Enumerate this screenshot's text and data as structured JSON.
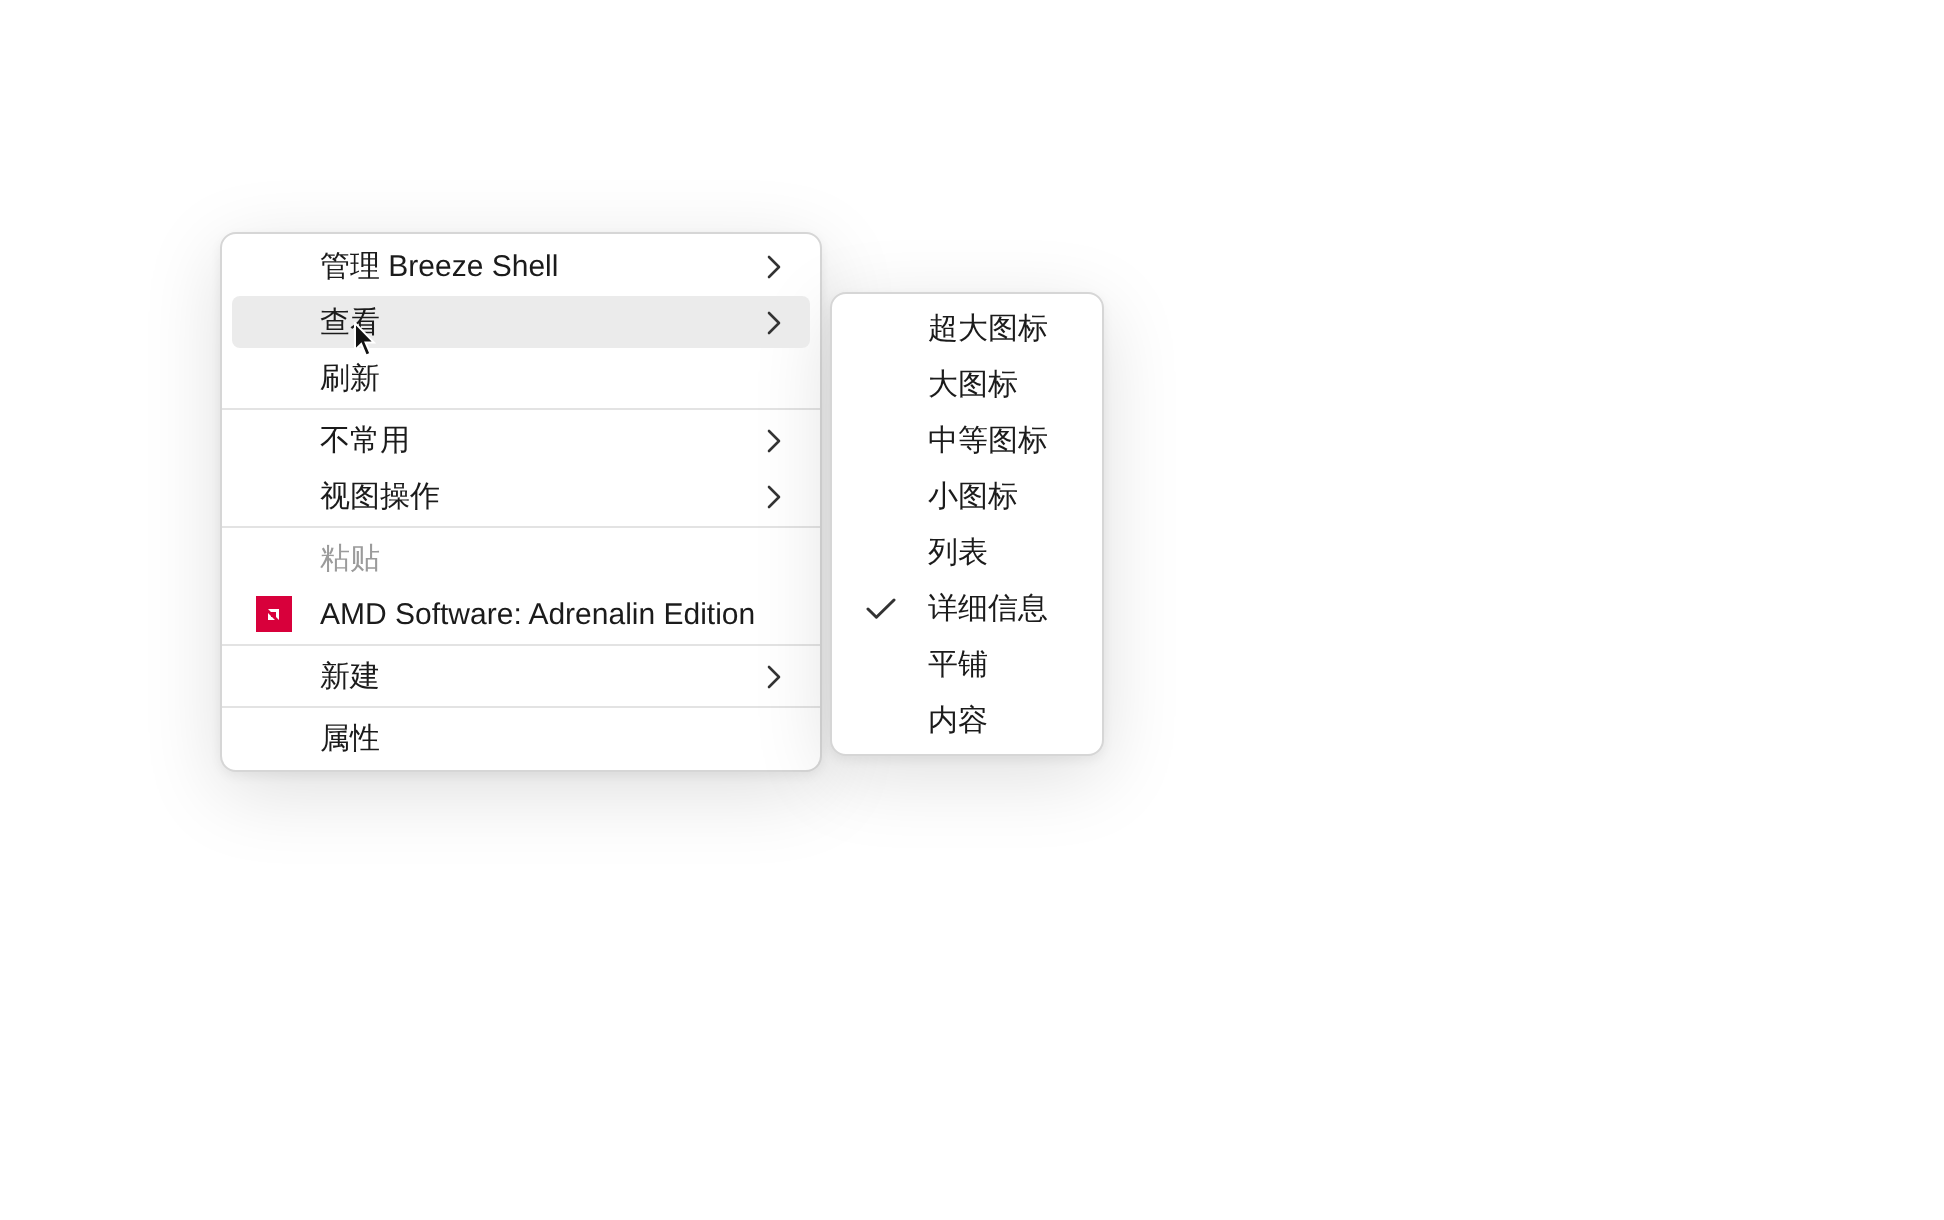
{
  "context_menu": {
    "items": [
      {
        "kind": "submenu",
        "label": "管理 Breeze Shell",
        "selected": false,
        "disabled": false
      },
      {
        "kind": "submenu",
        "label": "查看",
        "selected": true,
        "disabled": false
      },
      {
        "kind": "command",
        "label": "刷新",
        "selected": false,
        "disabled": false
      },
      {
        "kind": "separator"
      },
      {
        "kind": "submenu",
        "label": "不常用",
        "selected": false,
        "disabled": false
      },
      {
        "kind": "submenu",
        "label": "视图操作",
        "selected": false,
        "disabled": false
      },
      {
        "kind": "separator"
      },
      {
        "kind": "command",
        "label": "粘贴",
        "selected": false,
        "disabled": true
      },
      {
        "kind": "app",
        "label": "AMD Software: Adrenalin Edition",
        "selected": false,
        "disabled": false
      },
      {
        "kind": "separator"
      },
      {
        "kind": "submenu",
        "label": "新建",
        "selected": false,
        "disabled": false
      },
      {
        "kind": "separator"
      },
      {
        "kind": "command",
        "label": "属性",
        "selected": false,
        "disabled": false
      }
    ]
  },
  "view_submenu": {
    "items": [
      {
        "label": "超大图标",
        "checked": false
      },
      {
        "label": "大图标",
        "checked": false
      },
      {
        "label": "中等图标",
        "checked": false
      },
      {
        "label": "小图标",
        "checked": false
      },
      {
        "label": "列表",
        "checked": false
      },
      {
        "label": "详细信息",
        "checked": true
      },
      {
        "label": "平铺",
        "checked": false
      },
      {
        "label": "内容",
        "checked": false
      }
    ]
  }
}
